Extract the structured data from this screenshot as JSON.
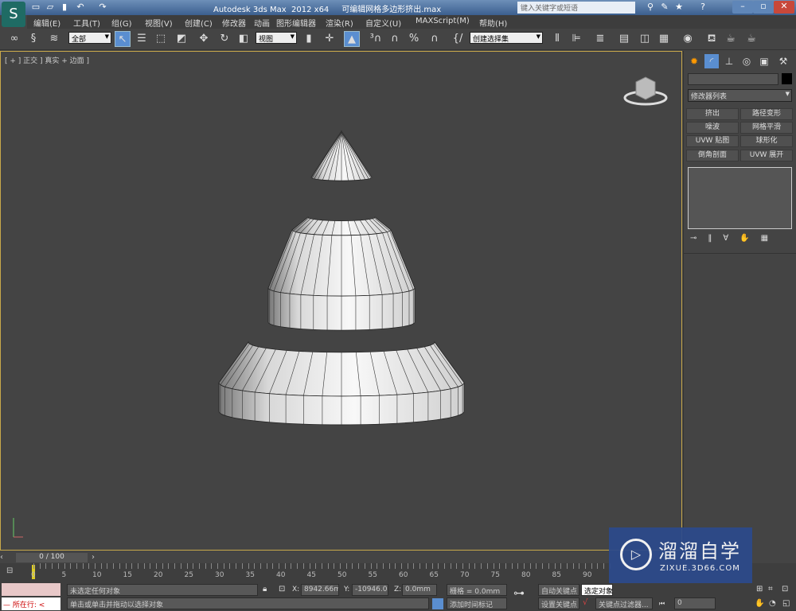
{
  "title": {
    "app": "Autodesk 3ds Max  2012 x64",
    "file": "可编辑网格多边形挤出.max",
    "search_placeholder": "键入关键字或短语"
  },
  "menu": [
    "编辑(E)",
    "工具(T)",
    "组(G)",
    "视图(V)",
    "创建(C)",
    "修改器",
    "动画",
    "图形编辑器",
    "渲染(R)",
    "自定义(U)",
    "MAXScript(M)",
    "帮助(H)"
  ],
  "toolbar": {
    "selection_filter": "全部",
    "reference_coord": "视图",
    "named_selection": "创建选择集"
  },
  "viewport": {
    "label": "[ + ] 正交 ] 真实 + 边面 ]"
  },
  "panel": {
    "modifier_list": "修改器列表",
    "modifiers": [
      "挤出",
      "路径变形",
      "噪波",
      "网格平滑",
      "UVW 贴图",
      "球形化",
      "倒角剖面",
      "UVW 展开"
    ]
  },
  "timeline": {
    "frame": "0 / 100",
    "ticks": [
      0,
      5,
      10,
      15,
      20,
      25,
      30,
      35,
      40,
      45,
      50,
      55,
      60,
      65,
      70,
      75,
      80,
      85,
      90
    ]
  },
  "status": {
    "selection": "未选定任何对象",
    "prompt": "单击或单击并拖动以选择对象",
    "running": "所在行:",
    "x": "8942.66mm",
    "y": "-10946.04",
    "z": "0.0mm",
    "grid": "栅格 = 0.0mm",
    "add_time_tag": "添加时间标记",
    "auto_key": "自动关键点",
    "set_key": "设置关键点",
    "selected": "选定对象",
    "key_filters": "关键点过滤器...",
    "frame_field": "0"
  },
  "watermark": {
    "brand": "溜溜自学",
    "url": "ZIXUE.3D66.COM"
  },
  "colors": {
    "accent": "#5a8ed0",
    "viewport_border": "#c8a84a",
    "watermark": "#2c4a8c"
  }
}
